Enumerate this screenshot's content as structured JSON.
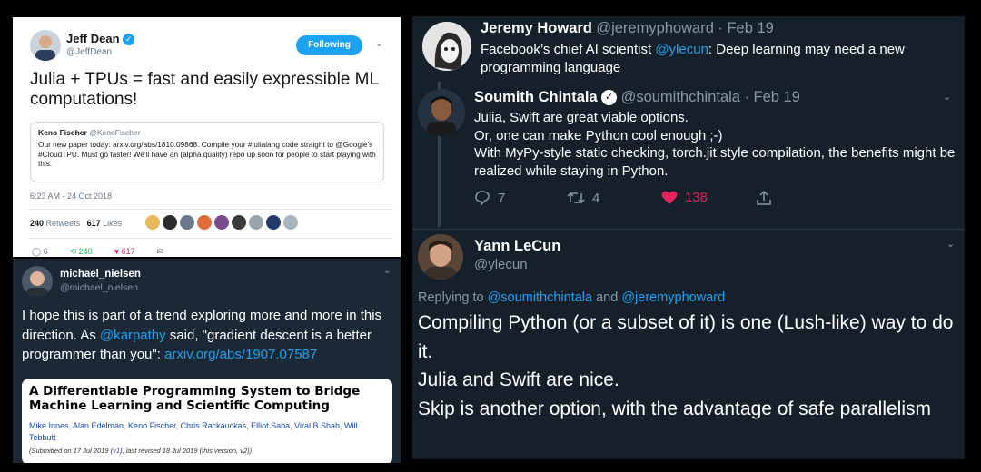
{
  "tweet_jeff": {
    "author_name": "Jeff Dean",
    "author_handle": "@JeffDean",
    "follow_label": "Following",
    "text": "Julia + TPUs = fast and easily expressible ML computations!",
    "quote": {
      "author_name": "Keno Fischer",
      "author_handle": "@KenoFischer",
      "text": "Our new paper today: arxiv.org/abs/1810.09868. Compile your #julialang code straight to @Google's #CloudTPU. Must go faster! We'll have an (alpha quality) repo up soon for people to start playing with this."
    },
    "timestamp": "6:23 AM - 24 Oct 2018",
    "retweets_count": "240",
    "retweets_label": "Retweets",
    "likes_count": "617",
    "likes_label": "Likes",
    "reply_count": "6",
    "retweet_action_count": "240",
    "like_action_count": "617",
    "liker_colors": [
      "#e8b85a",
      "#2b2b2b",
      "#6a7a8c",
      "#e06b3b",
      "#7a4b8c",
      "#3a3a3a",
      "#9aa4ad",
      "#1f3a6b",
      "#aab4bd"
    ]
  },
  "tweet_michael": {
    "author_name": "michael_nielsen",
    "author_handle": "@michael_nielsen",
    "text_before": "I hope this is part of a trend exploring more and more in this direction. As ",
    "mention": "@karpathy",
    "text_middle": " said, \"gradient descent is a better programmer than you\": ",
    "link": "arxiv.org/abs/1907.07587",
    "card": {
      "title": "A Differentiable Programming System to Bridge Machine Learning and Scientific Computing",
      "authors": "Mike Innes, Alan Edelman, Keno Fischer, Chris Rackauckas, Elliot Saba, Viral B Shah, Will Tebbutt",
      "submitted_prefix": "(Submitted on 17 Jul 2019 (",
      "v1": "v1",
      "submitted_suffix": "), last revised 18 Jul 2019 (this version, v2))"
    }
  },
  "thread": {
    "t1": {
      "author_name": "Jeremy Howard",
      "author_handle": "@jeremyphoward",
      "date": "· Feb 19",
      "text_before": "Facebook’s chief AI scientist ",
      "mention": "@ylecun",
      "text_after": ": Deep learning may need a new programming language"
    },
    "t2": {
      "author_name": "Soumith Chintala",
      "author_handle": "@soumithchintala",
      "date": "· Feb 19",
      "lines": [
        "Julia, Swift are great viable options.",
        "Or, one can make Python cool enough ;-)",
        "With MyPy-style static checking, torch.jit style compilation, the benefits might be realized while staying in Python."
      ],
      "reply_count": "7",
      "retweet_count": "4",
      "like_count": "138"
    },
    "t3": {
      "author_name": "Yann LeCun",
      "author_handle": "@ylecun",
      "replying_to_label": "Replying to ",
      "replying_to_1": "@soumithchintala",
      "replying_and": " and ",
      "replying_to_2": "@jeremyphoward",
      "lines": [
        "Compiling Python (or a subset of it) is one (Lush-like) way to do it.",
        "Julia and Swift are nice.",
        "Skip is another option, with the advantage of safe parallelism"
      ]
    }
  },
  "colors": {
    "twitter_blue": "#1da1f2",
    "like_red": "#e0245e",
    "dark_bg": "#15202b",
    "dim_bg": "#1b2836"
  }
}
